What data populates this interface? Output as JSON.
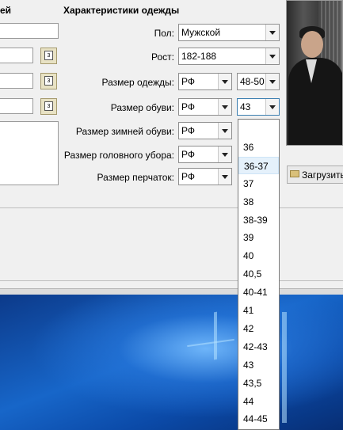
{
  "left_section": {
    "title_fragment": "ей"
  },
  "clothing": {
    "title": "Характеристики одежды",
    "gender": {
      "label": "Пол:",
      "value": "Мужской"
    },
    "height": {
      "label": "Рост:",
      "value": "182-188"
    },
    "clothing_size": {
      "label": "Размер одежды:",
      "system": "РФ",
      "value": "48-50"
    },
    "shoe_size": {
      "label": "Размер обуви:",
      "system": "РФ",
      "value": "43"
    },
    "winter_shoe_size": {
      "label": "Размер зимней обуви:",
      "system": "РФ"
    },
    "hat_size": {
      "label": "Размер головного убора:",
      "system": "РФ"
    },
    "glove_size": {
      "label": "Размер перчаток:",
      "system": "РФ"
    }
  },
  "photo": {
    "upload_label": "Загрузить"
  },
  "shoe_dropdown": {
    "options": [
      "",
      "36",
      "36-37",
      "37",
      "38",
      "38-39",
      "39",
      "40",
      "40,5",
      "40-41",
      "41",
      "42",
      "42-43",
      "43",
      "43,5",
      "44",
      "44-45"
    ],
    "highlighted": "36-37"
  }
}
